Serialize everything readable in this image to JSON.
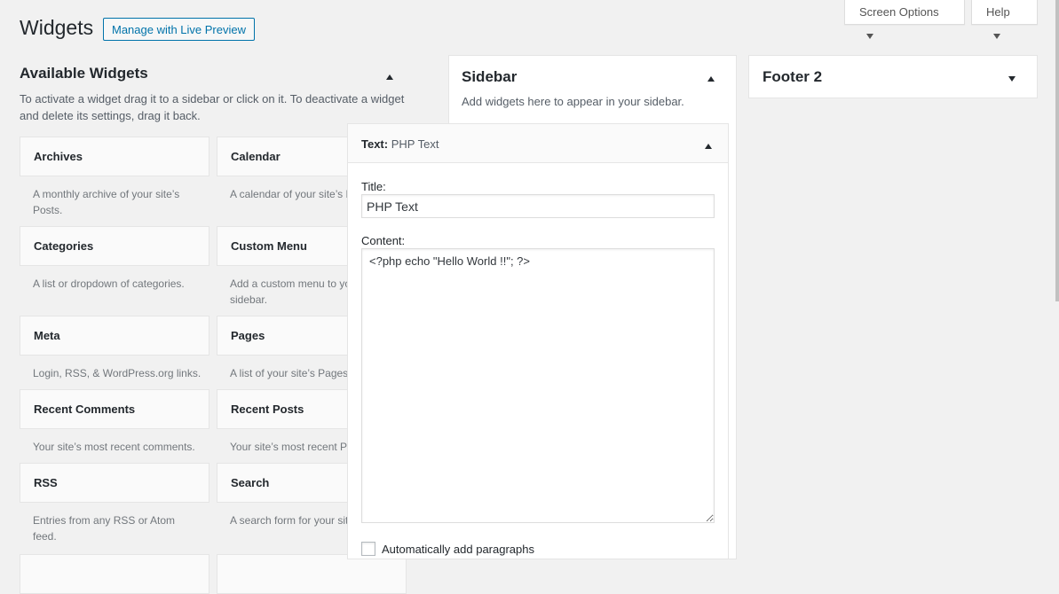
{
  "header": {
    "title": "Widgets",
    "live_preview": "Manage with Live Preview",
    "screen_options": "Screen Options",
    "help": "Help"
  },
  "available": {
    "title": "Available Widgets",
    "description": "To activate a widget drag it to a sidebar or click on it. To deactivate a widget and delete its settings, drag it back.",
    "widgets": [
      {
        "name": "Archives",
        "desc": "A monthly archive of your site’s Posts."
      },
      {
        "name": "Calendar",
        "desc": "A calendar of your site’s Posts."
      },
      {
        "name": "Categories",
        "desc": "A list or dropdown of categories."
      },
      {
        "name": "Custom Menu",
        "desc": "Add a custom menu to your sidebar."
      },
      {
        "name": "Meta",
        "desc": "Login, RSS, & WordPress.org links."
      },
      {
        "name": "Pages",
        "desc": "A list of your site’s Pages."
      },
      {
        "name": "Recent Comments",
        "desc": "Your site’s most recent comments."
      },
      {
        "name": "Recent Posts",
        "desc": "Your site’s most recent Posts."
      },
      {
        "name": "RSS",
        "desc": "Entries from any RSS or Atom feed."
      },
      {
        "name": "Search",
        "desc": "A search form for your site."
      }
    ]
  },
  "sidebar": {
    "title": "Sidebar",
    "description": "Add widgets here to appear in your sidebar."
  },
  "footer2": {
    "title": "Footer 2"
  },
  "text_widget": {
    "type_label": "Text:",
    "instance_title": "PHP Text",
    "title_label": "Title:",
    "title_value": "PHP Text",
    "content_label": "Content:",
    "content_value": "<?php echo \"Hello World !!\"; ?>",
    "auto_paragraphs": "Automatically add paragraphs"
  }
}
